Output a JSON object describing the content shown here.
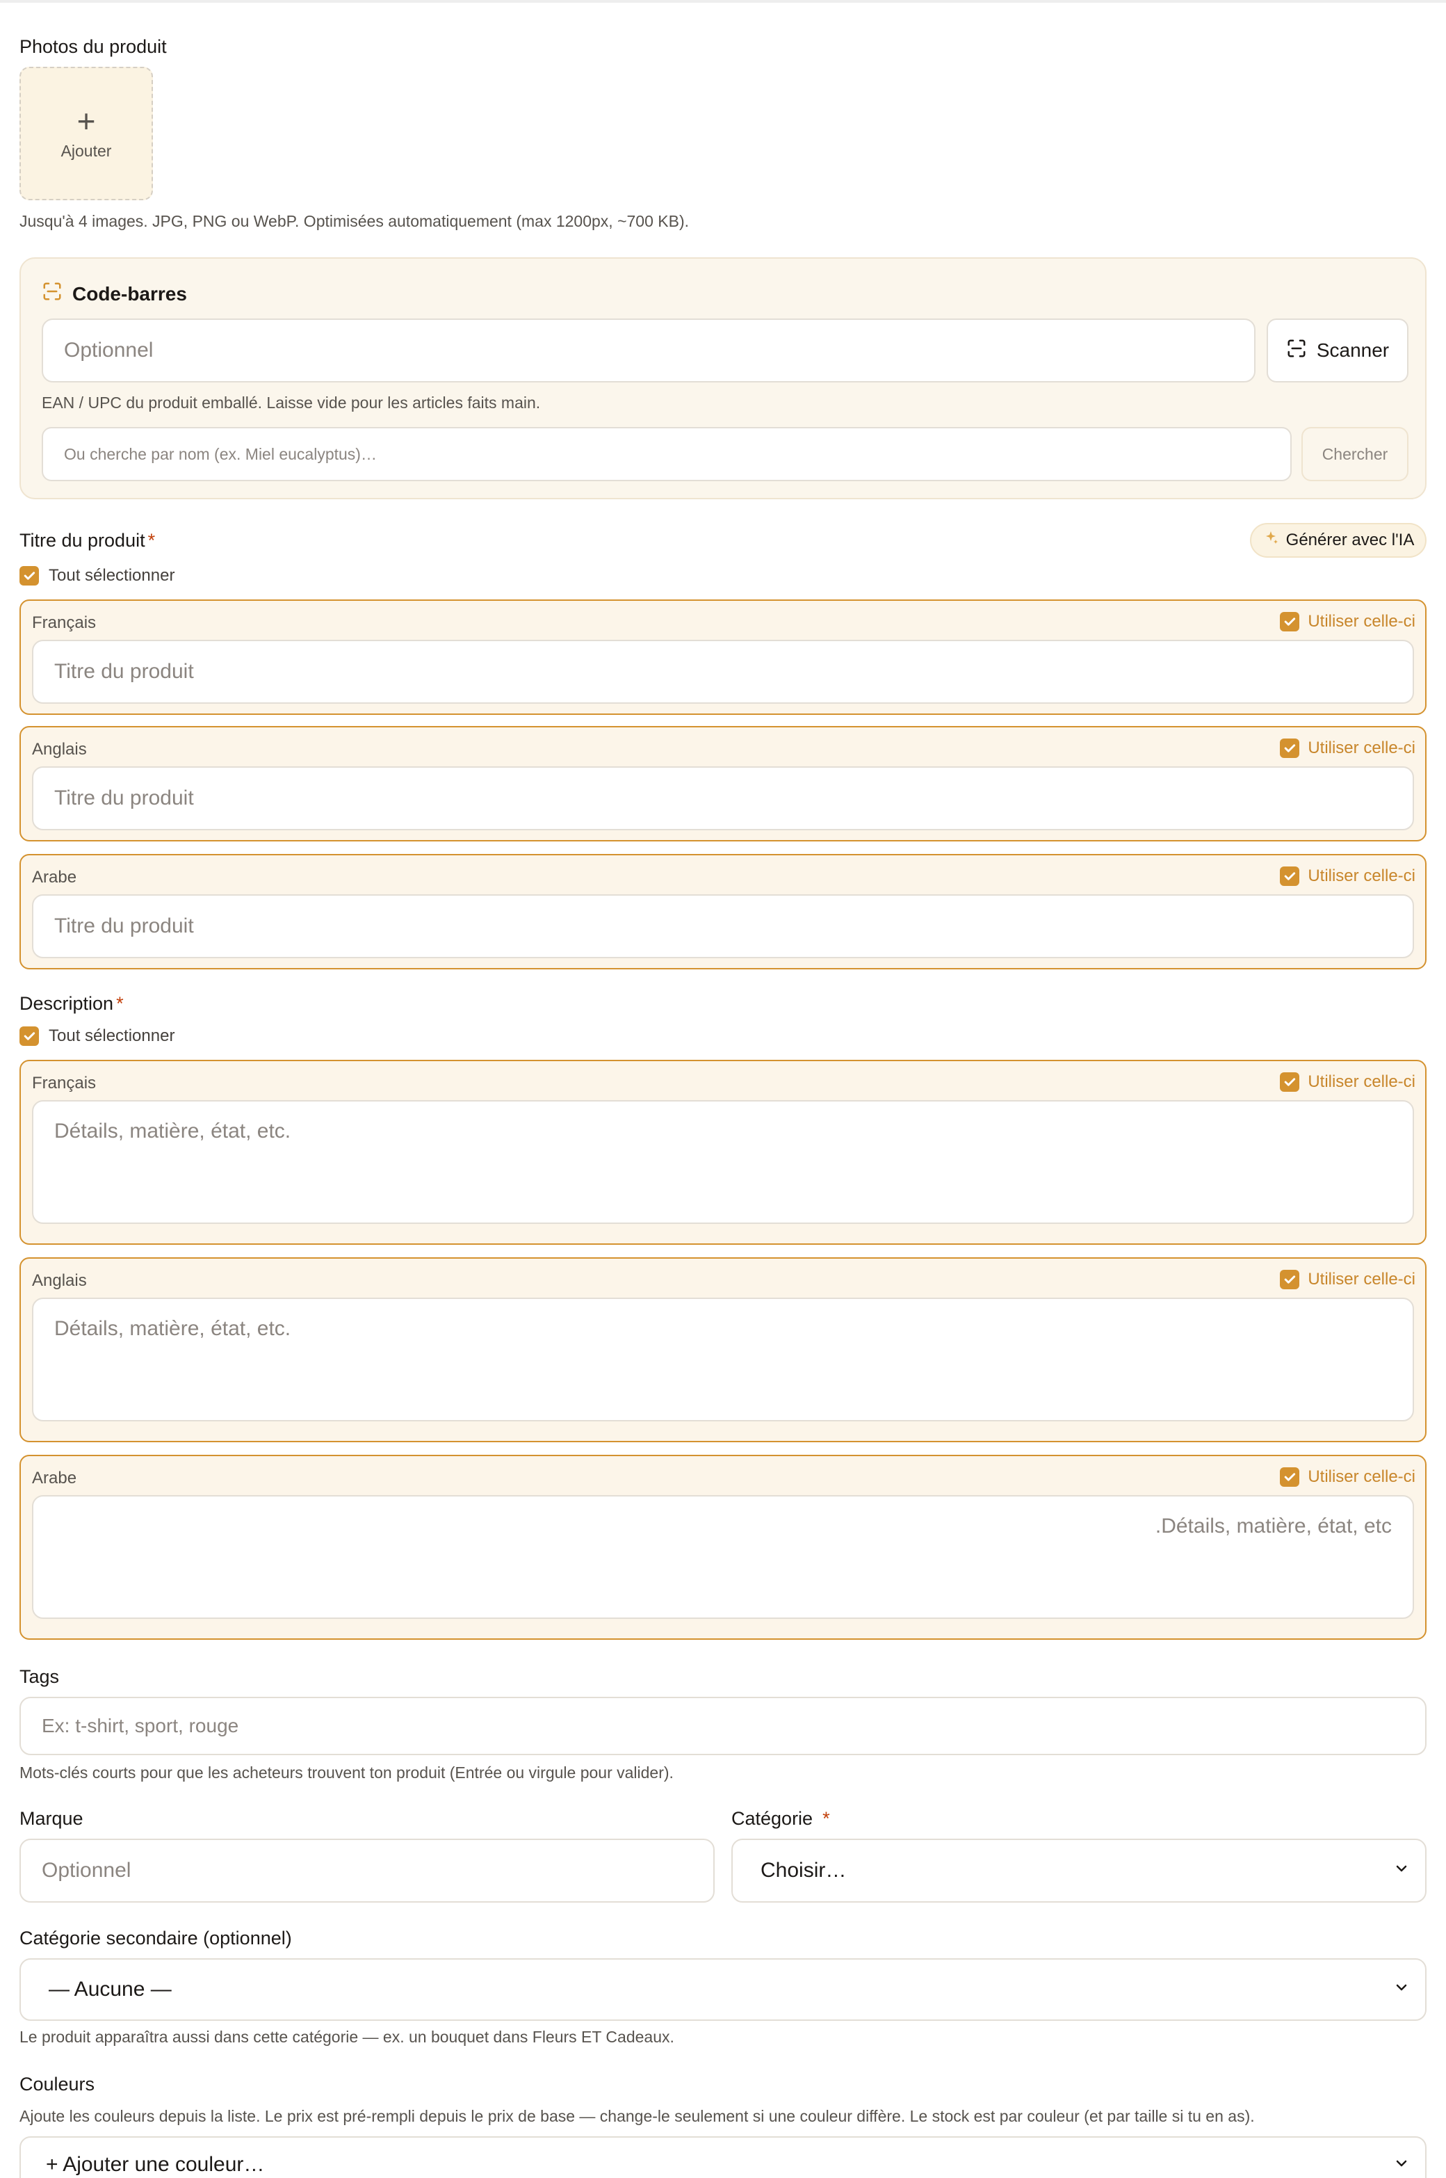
{
  "photos": {
    "label": "Photos du produit",
    "add_label": "Ajouter",
    "help": "Jusqu'à 4 images. JPG, PNG ou WebP. Optimisées automatiquement (max 1200px, ~700 KB)."
  },
  "barcode": {
    "title": "Code-barres",
    "placeholder": "Optionnel",
    "scan_label": "Scanner",
    "help": "EAN / UPC du produit emballé. Laisse vide pour les articles faits main.",
    "search_placeholder": "Ou cherche par nom (ex. Miel eucalyptus)…",
    "search_button": "Chercher"
  },
  "title_section": {
    "label": "Titre du produit",
    "required": "*",
    "ai_button": "Générer avec l'IA",
    "select_all": "Tout sélectionner",
    "langs": [
      {
        "name": "Français",
        "use": "Utiliser celle-ci",
        "placeholder": "Titre du produit"
      },
      {
        "name": "Anglais",
        "use": "Utiliser celle-ci",
        "placeholder": "Titre du produit"
      },
      {
        "name": "Arabe",
        "use": "Utiliser celle-ci",
        "placeholder": "Titre du produit"
      }
    ]
  },
  "description_section": {
    "label": "Description",
    "required": "*",
    "select_all": "Tout sélectionner",
    "langs": [
      {
        "name": "Français",
        "use": "Utiliser celle-ci",
        "placeholder": "Détails, matière, état, etc."
      },
      {
        "name": "Anglais",
        "use": "Utiliser celle-ci",
        "placeholder": "Détails, matière, état, etc."
      },
      {
        "name": "Arabe",
        "use": "Utiliser celle-ci",
        "placeholder": ".Détails, matière, état, etc"
      }
    ]
  },
  "tags": {
    "label": "Tags",
    "placeholder": "Ex: t-shirt, sport, rouge",
    "help": "Mots-clés courts pour que les acheteurs trouvent ton produit (Entrée ou virgule pour valider)."
  },
  "brand": {
    "label": "Marque",
    "placeholder": "Optionnel"
  },
  "category": {
    "label": "Catégorie",
    "required": "*",
    "selected": "Choisir…"
  },
  "secondary_category": {
    "label": "Catégorie secondaire (optionnel)",
    "selected": "— Aucune —",
    "help": "Le produit apparaîtra aussi dans cette catégorie — ex. un bouquet dans Fleurs ET Cadeaux."
  },
  "colors": {
    "label": "Couleurs",
    "help": "Ajoute les couleurs depuis la liste. Le prix est pré-rempli depuis le prix de base — change-le seulement si une couleur diffère. Le stock est par couleur (et par taille si tu en as).",
    "selected": "+ Ajouter une couleur…"
  },
  "theme": {
    "accent": "#d4922f",
    "panel_bg": "#fbf6ec",
    "lang_bg": "#fcf5e9"
  }
}
